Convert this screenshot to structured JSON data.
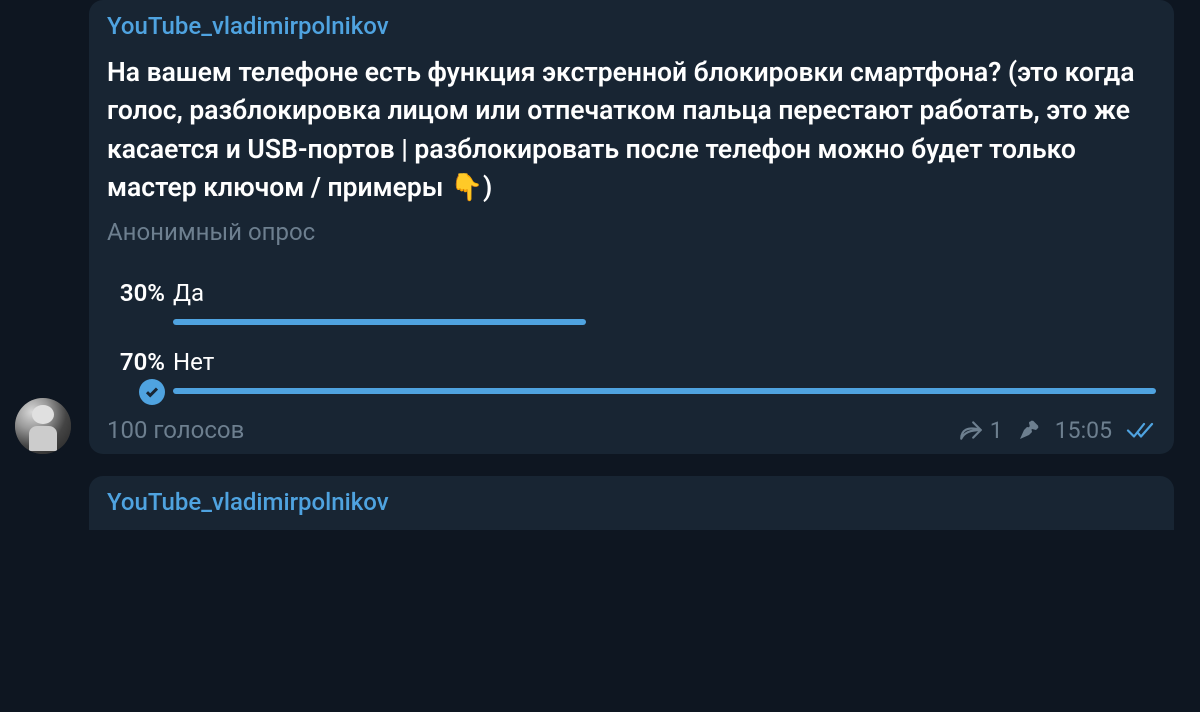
{
  "message1": {
    "channel_name": "YouTube_vladimirpolnikov",
    "poll_question": "На вашем телефоне есть функция экстренной блокировки смартфона? (это когда голос, разблокировка лицом или отпечатком пальца перестают работать, это же касается и USB-портов | разблокировать после телефон можно будет только мастер ключом / примеры 👇)",
    "poll_type": "Анонимный опрос",
    "options": [
      {
        "percent": "30%",
        "label": "Да",
        "width": 42,
        "voted": false
      },
      {
        "percent": "70%",
        "label": "Нет",
        "width": 100,
        "voted": true
      }
    ],
    "votes_text": "100 голосов",
    "share_count": "1",
    "time": "15:05"
  },
  "message2": {
    "channel_name": "YouTube_vladimirpolnikov"
  }
}
